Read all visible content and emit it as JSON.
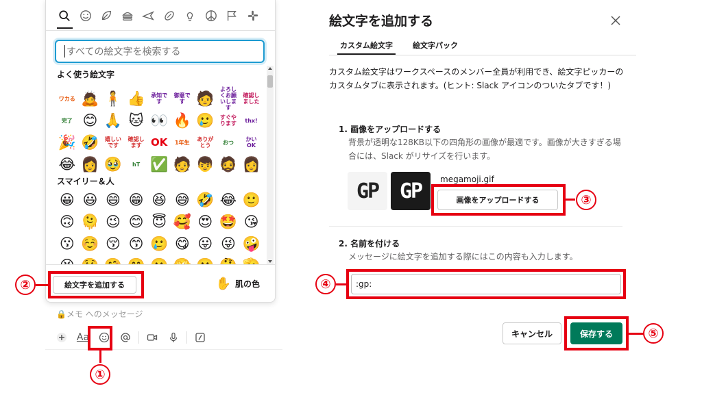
{
  "picker": {
    "categories": [
      "search-icon",
      "smiley-icon",
      "leaf-icon",
      "burger-icon",
      "plane-icon",
      "ball-icon",
      "bulb-icon",
      "peace-icon",
      "flag-icon",
      "slack-icon"
    ],
    "search_placeholder": "すべての絵文字を検索する",
    "section_frequent": "よく使う絵文字",
    "frequent_rows": [
      [
        {
          "t": "ワカる"
        },
        {
          "e": "🙇"
        },
        {
          "e": "🧍"
        },
        {
          "e": "👍"
        },
        {
          "t": "承知です"
        },
        {
          "t": "御意です"
        },
        {
          "e": "🧑"
        },
        {
          "t": "よろしくお願いします"
        },
        {
          "t": "確認しました"
        }
      ],
      [
        {
          "t": "完了"
        },
        {
          "e": "😊"
        },
        {
          "e": "🙏"
        },
        {
          "e": "🐱"
        },
        {
          "e": "👀"
        },
        {
          "e": "🔥"
        },
        {
          "e": "🥲"
        },
        {
          "t": "すぐやります"
        },
        {
          "t": "thx!"
        }
      ],
      [
        {
          "e": "🎉"
        },
        {
          "e": "🤣"
        },
        {
          "t": "嬉しいです"
        },
        {
          "t": "確認します"
        },
        {
          "t": "OK"
        },
        {
          "t": "1年生"
        },
        {
          "t": "ありがとう"
        },
        {
          "t": "おつ"
        },
        {
          "t": "かいOK"
        }
      ],
      [
        {
          "e": "😂"
        },
        {
          "e": "👩"
        },
        {
          "e": "🥹"
        },
        {
          "t": "hT"
        },
        {
          "e": "✅"
        },
        {
          "e": "🧑"
        },
        {
          "e": "👦"
        },
        {
          "e": "🧔"
        },
        {
          "e": "👩"
        }
      ]
    ],
    "section_smileys": "スマイリー＆人",
    "smiley_rows": [
      [
        "😀",
        "😃",
        "😄",
        "😁",
        "😆",
        "😅",
        "🤣",
        "😂",
        "🙂"
      ],
      [
        "🙃",
        "🫠",
        "😉",
        "😊",
        "😇",
        "🥰",
        "😍",
        "🤩",
        "😘"
      ],
      [
        "😗",
        "☺️",
        "😚",
        "😙",
        "🥲",
        "😋",
        "😛",
        "😜",
        "🤪"
      ],
      [
        "😝",
        "🤑",
        "🤗",
        "🤭",
        "🫢",
        "🫣",
        "🤫",
        "🤔",
        "🫡"
      ]
    ],
    "add_emoji_label": "絵文字を追加する",
    "skin_tone_icon": "✋",
    "skin_tone_label": "肌の色"
  },
  "composer": {
    "placeholder": "🔒メモ へのメッセージ",
    "format_label": "Aa"
  },
  "dialog": {
    "title": "絵文字を追加する",
    "tabs": [
      "カスタム絵文字",
      "絵文字パック"
    ],
    "description": "カスタム絵文字はワークスペースのメンバー全員が利用でき、絵文字ピッカーのカスタムタブに表示されます。(ヒント: Slack アイコンのついたタブです！)",
    "step1_title": "1. 画像をアップロードする",
    "step1_desc": "背景が透明な128KB以下の四角形の画像が最適です。画像が大きすぎる場合には、Slack がリサイズを行います。",
    "preview_text": "GP",
    "file_name": "megamoji.gif",
    "upload_button": "画像をアップロードする",
    "step2_title": "2. 名前を付ける",
    "step2_desc": "メッセージに絵文字を追加する際にはこの内容も入力します。",
    "name_value": ":gp:",
    "cancel": "キャンセル",
    "save": "保存する"
  },
  "annotations": [
    "①",
    "②",
    "③",
    "④",
    "⑤"
  ],
  "colors": {
    "highlight": "#e60012",
    "save": "#007a5a",
    "focus": "#1d9bd1"
  }
}
